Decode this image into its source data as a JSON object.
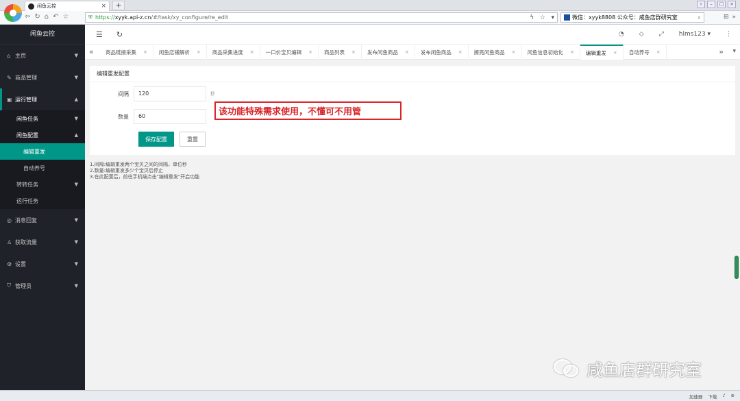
{
  "browser": {
    "tab_title": "闲鱼云控",
    "tab_close": "×",
    "new_tab": "+",
    "url_https": "https://",
    "url_host": "xyyk.api-z.cn",
    "url_path": "/#/task/xy_configure/re_edit",
    "search_text": "微信：xyyk8808  公众号：咸鱼店群研究室",
    "status_items": [
      "加速器",
      "下载"
    ]
  },
  "sidebar": {
    "logo": "闲鱼云控",
    "items": [
      {
        "label": "主页",
        "icon": "home-icon"
      },
      {
        "label": "商品管理",
        "icon": "pencil-icon"
      },
      {
        "label": "运行管理",
        "icon": "clipboard-icon"
      },
      {
        "label": "消息回复",
        "icon": "message-icon"
      },
      {
        "label": "获取流量",
        "icon": "user-icon"
      },
      {
        "label": "设置",
        "icon": "gear-icon"
      },
      {
        "label": "管理员",
        "icon": "shield-icon"
      }
    ],
    "sub": {
      "xianyu_task": "闲鱼任务",
      "xianyu_config": "闲鱼配置",
      "edit_repost": "编辑重发",
      "auto_nurture": "自动养号",
      "zhuanzhuan_task": "转转任务",
      "run_task": "运行任务"
    }
  },
  "header": {
    "user": "hlms123"
  },
  "page_tabs": [
    {
      "label": "商品链接采集",
      "active": false
    },
    {
      "label": "闲鱼店铺解析",
      "active": false
    },
    {
      "label": "商品采集进度",
      "active": false
    },
    {
      "label": "一口价宝贝编辑",
      "active": false
    },
    {
      "label": "商品列表",
      "active": false
    },
    {
      "label": "发布闲鱼商品",
      "active": false
    },
    {
      "label": "发布闲鱼商品",
      "active": false
    },
    {
      "label": "擦亮闲鱼商品",
      "active": false
    },
    {
      "label": "闲鱼信息初始化",
      "active": false
    },
    {
      "label": "编辑重发",
      "active": true
    },
    {
      "label": "自动养号",
      "active": false
    }
  ],
  "card": {
    "title": "编辑重发配置",
    "interval_label": "间隔",
    "interval_value": "120",
    "interval_unit": "秒",
    "count_label": "数量",
    "count_value": "60",
    "save_label": "保存配置",
    "reset_label": "重置"
  },
  "annotation": "该功能特殊需求使用，不懂可不用管",
  "notes": [
    "1.间隔:编辑重发两个宝贝之间的间隔，单位秒",
    "2.数量:编辑重发多少个宝贝后停止",
    "3.在此配置后，前往手机端点击\"编辑重发\"开启功能"
  ],
  "watermark": "咸鱼店群研究室",
  "colors": {
    "accent": "#009688",
    "sidebar_bg": "#20222a",
    "annotation_red": "#d9252a"
  }
}
